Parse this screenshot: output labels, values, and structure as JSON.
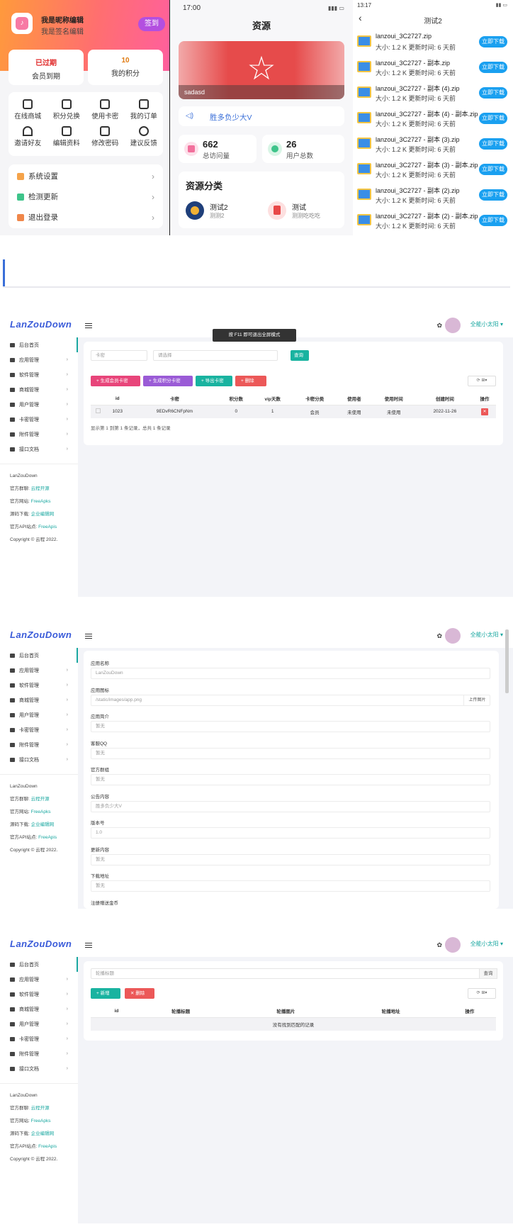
{
  "profile": {
    "nickname": "我是昵称编辑",
    "signature": "我是签名编辑",
    "sign_btn": "签到",
    "stats": [
      {
        "value": "已过期",
        "label": "会员到期",
        "color": "#e02a2a"
      },
      {
        "value": "10",
        "label": "我的积分",
        "color": "#e07a10"
      }
    ],
    "grid": [
      "在线商城",
      "积分兑换",
      "使用卡密",
      "我的订单",
      "邀请好友",
      "编辑资料",
      "修改密码",
      "建议反馈"
    ],
    "menu": [
      {
        "label": "系统设置",
        "color": "#f5a34a"
      },
      {
        "label": "检测更新",
        "color": "#3ec48a"
      },
      {
        "label": "退出登录",
        "color": "#f0874a"
      }
    ]
  },
  "resources": {
    "status_time": "17:00",
    "title": "资源",
    "banner_caption": "sadasd",
    "notice": "胜多负少大V",
    "stats": [
      {
        "value": "662",
        "label": "总访问量"
      },
      {
        "value": "26",
        "label": "用户总数"
      }
    ],
    "category_title": "资源分类",
    "categories": [
      {
        "name": "测试2",
        "desc": "测测2"
      },
      {
        "name": "测试",
        "desc": "测测吃吃吃"
      }
    ]
  },
  "files": {
    "status_time": "13:17",
    "title": "测试2",
    "download_label": "立即下载",
    "items": [
      {
        "name": "lanzoui_3C2727.zip",
        "meta": "大小:  1.2 K  更新时间:  6 天前"
      },
      {
        "name": "lanzoui_3C2727 - 副本.zip",
        "meta": "大小:  1.2 K  更新时间:  6 天前"
      },
      {
        "name": "lanzoui_3C2727 - 副本 (4).zip",
        "meta": "大小:  1.2 K  更新时间:  6 天前"
      },
      {
        "name": "lanzoui_3C2727 - 副本 (4) - 副本.zip",
        "meta": "大小:  1.2 K  更新时间:  6 天前"
      },
      {
        "name": "lanzoui_3C2727 - 副本 (3).zip",
        "meta": "大小:  1.2 K  更新时间:  6 天前"
      },
      {
        "name": "lanzoui_3C2727 - 副本 (3) - 副本.zip",
        "meta": "大小:  1.2 K  更新时间:  6 天前"
      },
      {
        "name": "lanzoui_3C2727 - 副本 (2).zip",
        "meta": "大小:  1.2 K  更新时间:  6 天前"
      },
      {
        "name": "lanzoui_3C2727 - 副本 (2) - 副本.zip",
        "meta": "大小:  1.2 K  更新时间:  6 天前"
      }
    ]
  },
  "admin": {
    "logo": "LanZouDown",
    "user": "全能小太阳 ▾",
    "palette_icon": "palette-icon",
    "sidebar": [
      "后台首页",
      "应用管理",
      "软件管理",
      "商城管理",
      "用户管理",
      "卡密管理",
      "附件管理",
      "接口文档"
    ],
    "footer": {
      "name": "LanZouDown",
      "group_label": "官方群聊:",
      "group_val": "云程开源",
      "site_label": "官方网站:",
      "site_val": "FreeApks",
      "src_label": "源码下载:",
      "src_val": "企业编辑网",
      "api_label": "官方API站点:",
      "api_val": "FreeApis",
      "copyright": "Copyright © 云程 2022."
    }
  },
  "cards": {
    "fullscreen_tip": "按 F11 即可退出全屏模式",
    "search_ph": "卡密",
    "select_ph": "请选择",
    "query": "查询",
    "buttons": [
      "生成会员卡密",
      "生成积分卡密",
      "导出卡密",
      "删除"
    ],
    "columns": [
      "id",
      "卡密",
      "积分数",
      "vip天数",
      "卡密分类",
      "使用者",
      "使用时间",
      "创建时间",
      "操作"
    ],
    "row": [
      "1023",
      "9EDvR6CNFpNm",
      "0",
      "1",
      "会员",
      "未使用",
      "未使用",
      "2022-11-26"
    ],
    "pager": "显示第 1 到第 1 条记录，总共 1 条记录"
  },
  "settings": {
    "fields": [
      {
        "label": "应用名称",
        "value": "LanZouDown"
      },
      {
        "label": "应用图标",
        "value": "/static/images/app.png",
        "btn": "上传图片"
      },
      {
        "label": "应用简介",
        "value": "暂无"
      },
      {
        "label": "客服QQ",
        "value": "暂无"
      },
      {
        "label": "官方群组",
        "value": "暂无"
      },
      {
        "label": "公告内容",
        "value": "胜多负少大V"
      },
      {
        "label": "版本号",
        "value": "1.0"
      },
      {
        "label": "更新内容",
        "value": "暂无"
      },
      {
        "label": "下载地址",
        "value": "暂无"
      }
    ],
    "last_label": "注册赠送金币"
  },
  "banners": {
    "search_ph": "轮播标题",
    "query": "查询",
    "buttons": [
      "新增",
      "删除"
    ],
    "columns": [
      "id",
      "轮播标题",
      "轮播图片",
      "轮播地址",
      "操作"
    ],
    "empty": "没有找到匹配的记录"
  }
}
